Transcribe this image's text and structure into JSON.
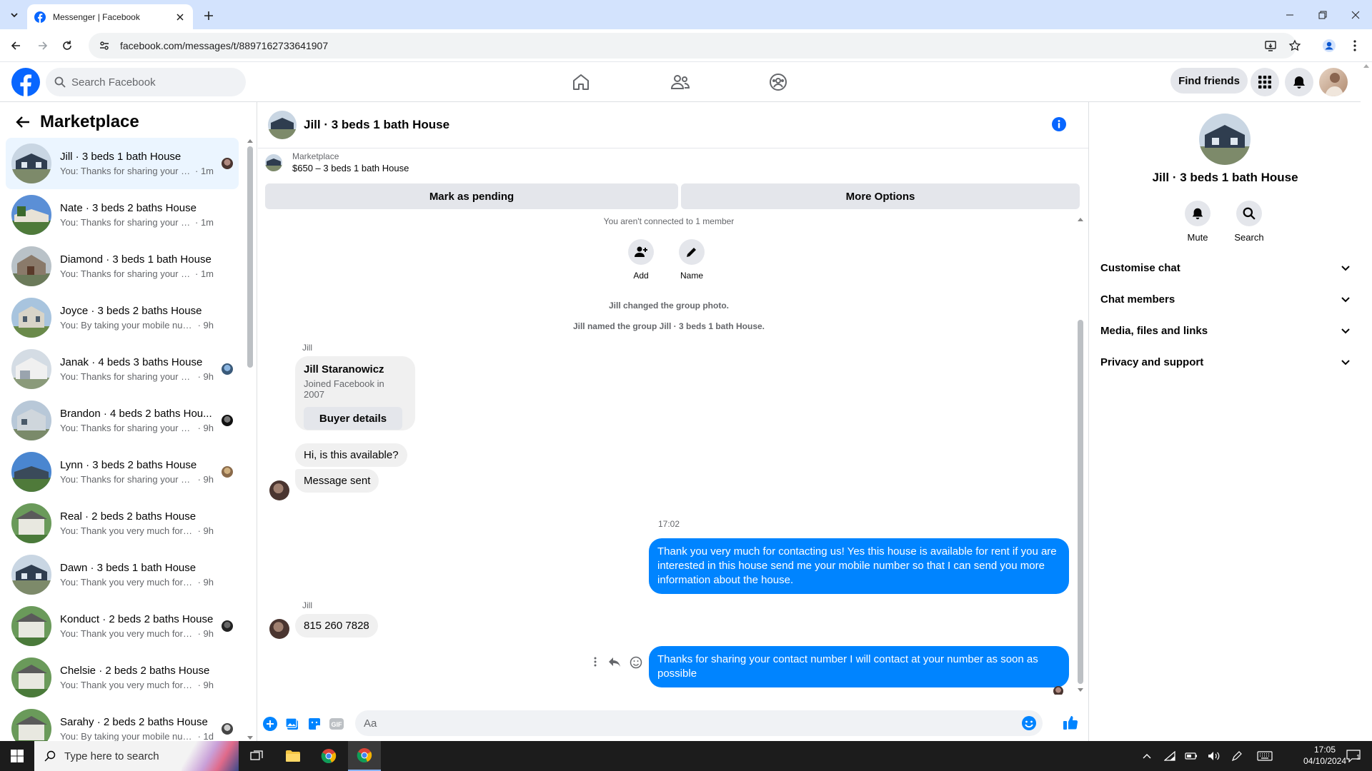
{
  "browser": {
    "tab_title": "Messenger | Facebook",
    "url": "facebook.com/messages/t/8897162733641907"
  },
  "fb": {
    "search_placeholder": "Search Facebook",
    "find_friends": "Find friends"
  },
  "sidebar": {
    "title": "Marketplace",
    "conversations": [
      {
        "name": "Jill · 3 beds 1 bath House",
        "preview": "You: Thanks for sharing your co...",
        "time": "· 1m",
        "active": true
      },
      {
        "name": "Nate · 3 beds 2 baths House",
        "preview": "You: Thanks for sharing your conta...",
        "time": "· 1m"
      },
      {
        "name": "Diamond · 3 beds 1 bath House",
        "preview": "You: Thanks for sharing your conta...",
        "time": "· 1m"
      },
      {
        "name": "Joyce · 3 beds 2 baths House",
        "preview": "You: By taking your mobile number...",
        "time": "· 9h"
      },
      {
        "name": "Janak · 4 beds 3 baths House",
        "preview": "You: Thanks for sharing your co...",
        "time": "· 9h"
      },
      {
        "name": "Brandon · 4 beds 2 baths Hou...",
        "preview": "You: Thanks for sharing your co...",
        "time": "· 9h"
      },
      {
        "name": "Lynn · 3 beds 2 baths House",
        "preview": "You: Thanks for sharing your co...",
        "time": "· 9h"
      },
      {
        "name": "Real · 2 beds 2 baths House",
        "preview": "You: Thank you very much for cont...",
        "time": "· 9h"
      },
      {
        "name": "Dawn · 3 beds 1 bath House",
        "preview": "You: Thank you very much for cont...",
        "time": "· 9h"
      },
      {
        "name": "Konduct · 2 beds 2 baths House",
        "preview": "You: Thank you very much for c...",
        "time": "· 9h"
      },
      {
        "name": "Chelsie · 2 beds 2 baths House",
        "preview": "You: Thank you very much for cont...",
        "time": "· 9h"
      },
      {
        "name": "Sarahy · 2 beds 2 baths House",
        "preview": "You: By taking your mobile num...",
        "time": "· 1d"
      }
    ]
  },
  "chat": {
    "title": "Jill · 3 beds 1 bath House",
    "marketplace_label": "Marketplace",
    "listing": "$650 – 3 beds 1 bath House",
    "mark_pending": "Mark as pending",
    "more_options": "More Options",
    "not_connected": "You aren't connected to 1 member",
    "add_label": "Add",
    "name_label": "Name",
    "sys1": "Jill changed the group photo.",
    "sys2": "Jill named the group Jill · 3 beds 1 bath House.",
    "sender": "Jill",
    "card_name": "Jill Staranowicz",
    "card_joined": "Joined Facebook in 2007",
    "buyer_details": "Buyer details",
    "msg1": "Hi, is this available?",
    "msg2": "Message sent",
    "time_divider": "17:02",
    "out1": "Thank you very much for contacting us! Yes this house is available for rent if you are interested in this house send me your mobile number so that I can send you more information about the house.",
    "msg3": "815 260 7828",
    "out2": "Thanks for sharing your contact number I will contact at your number as soon as possible",
    "composer_placeholder": "Aa"
  },
  "rpanel": {
    "title": "Jill · 3 beds 1 bath House",
    "mute": "Mute",
    "search": "Search",
    "sections": [
      "Customise chat",
      "Chat members",
      "Media, files and links",
      "Privacy and support"
    ]
  },
  "taskbar": {
    "search_placeholder": "Type here to search",
    "time": "17:05",
    "date": "04/10/2024",
    "notif_count": "1"
  },
  "colors": {
    "fb_blue": "#0866ff",
    "messenger_blue": "#0084ff",
    "tabstrip": "#d3e3fd"
  }
}
